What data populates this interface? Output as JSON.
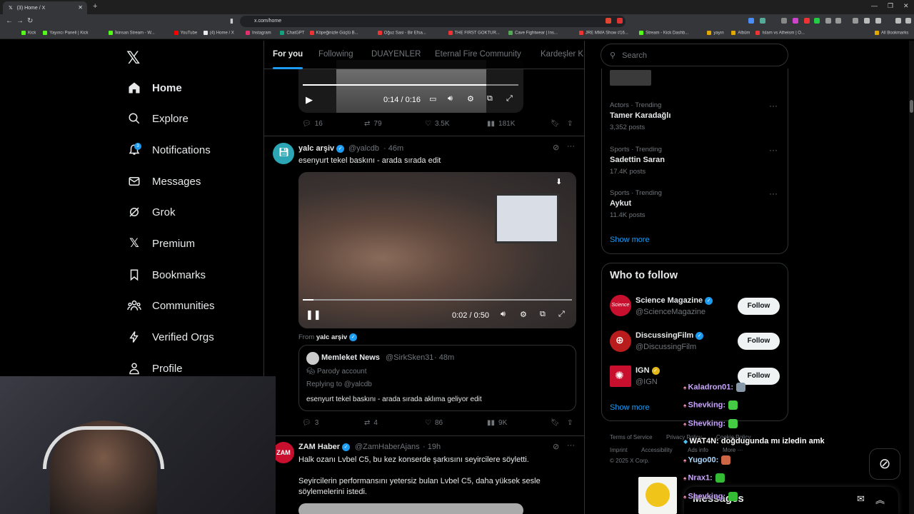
{
  "browser": {
    "tab_title": "(3) Home / X",
    "url": "x.com/home",
    "bookmarks": [
      "Kick",
      "Yayıncı Paneli | Kick",
      "İkinsan Stream - W...",
      "YouTube",
      "(4) Home / X",
      "Instagram",
      "ChatGPT",
      "Köpeğinizle Güçlü B...",
      "Oğuz Sasi - Bir Efsa...",
      "THE FIRST GOKTUR...",
      "Cave Fightwear | Ins...",
      "JRE MMA Show #16...",
      "Stream - Kick Dashb...",
      "yayın",
      "Albüm",
      "Islam vs Atheism | O...",
      "All Bookmarks"
    ]
  },
  "nav": {
    "items": [
      {
        "label": "Home"
      },
      {
        "label": "Explore"
      },
      {
        "label": "Notifications",
        "badge": "3"
      },
      {
        "label": "Messages"
      },
      {
        "label": "Grok"
      },
      {
        "label": "Premium"
      },
      {
        "label": "Bookmarks"
      },
      {
        "label": "Communities"
      },
      {
        "label": "Verified Orgs"
      },
      {
        "label": "Profile"
      }
    ]
  },
  "feed": {
    "tabs": [
      "For you",
      "Following",
      "DUAYENLER",
      "Eternal Fire Community",
      "Kardeşler K"
    ],
    "post0": {
      "video_time": "0:14 / 0:16",
      "video_progress": 0.85,
      "replies": "16",
      "reposts": "79",
      "likes": "3.5K",
      "views": "181K"
    },
    "post1": {
      "name": "yalc arşiv",
      "handle": "@yalcdb",
      "time": "· 46m",
      "text": "esenyurt tekel baskını - arada sırada edit",
      "video_time": "0:02 / 0:50",
      "video_progress": 0.04,
      "from_label": "From",
      "from_name": "yalc arşiv",
      "quote": {
        "name": "Memleket News",
        "handle": "@SirkSken31",
        "time": "· 48m",
        "parody": "Parody account",
        "replying": "Replying to @yalcdb",
        "text": "esenyurt tekel baskını - arada sırada aklıma geliyor edit"
      },
      "replies": "3",
      "reposts": "4",
      "likes": "86",
      "views": "9K"
    },
    "post2": {
      "name": "ZAM Haber",
      "handle": "@ZamHaberAjans",
      "time": "· 19h",
      "avatar_text": "ZAM",
      "text1": "Halk ozanı Lvbel C5, bu kez konserde şarkısını seyircilere söyletti.",
      "text2": "Seyircilerin performansını yetersiz bulan Lvbel C5, daha yüksek sesle söylemelerini istedi."
    }
  },
  "sidebar": {
    "search_placeholder": "Search",
    "trends": [
      {
        "meta": "Actors · Trending",
        "title": "Tamer Karadağlı",
        "posts": "3,352 posts"
      },
      {
        "meta": "Sports · Trending",
        "title": "Sadettin Saran",
        "posts": "17.4K posts"
      },
      {
        "meta": "Sports · Trending",
        "title": "Aykut",
        "posts": "11.4K posts"
      }
    ],
    "show_more": "Show more",
    "who_to_follow": "Who to follow",
    "follow_label": "Follow",
    "accounts": [
      {
        "name": "Science Magazine",
        "handle": "@ScienceMagazine",
        "avatar": "Science"
      },
      {
        "name": "DiscussingFilm",
        "handle": "@DiscussingFilm"
      },
      {
        "name": "IGN",
        "handle": "@IGN"
      }
    ],
    "show_more2": "Show more",
    "footer": [
      "Terms of Service",
      "Privacy Policy",
      "Cookie Policy",
      "Imprint",
      "Accessibility",
      "Ads info",
      "More ···",
      "© 2025 X Corp."
    ]
  },
  "chat": [
    {
      "user": "Kaladron01:",
      "msg": "",
      "color": "#c9a4ff"
    },
    {
      "user": "Shevking:",
      "msg": "",
      "color": "#c9a4ff"
    },
    {
      "user": "Shevking:",
      "msg": "",
      "color": "#c9a4ff"
    },
    {
      "user": "WAT4N:",
      "msg": "doğdugunda mı izledin amk",
      "color": "#ffffff"
    },
    {
      "user": "Yugo00:",
      "msg": "",
      "color": "#a8d8ff"
    },
    {
      "user": "Nrax1:",
      "msg": "",
      "color": "#c9a4ff"
    },
    {
      "user": "Shevking:",
      "msg": "",
      "color": "#c9a4ff"
    }
  ],
  "messages_bar": "Messages",
  "colors": {
    "accent": "#1d9bf0",
    "background": "#000000",
    "border": "#2f3336",
    "muted": "#71767b"
  }
}
